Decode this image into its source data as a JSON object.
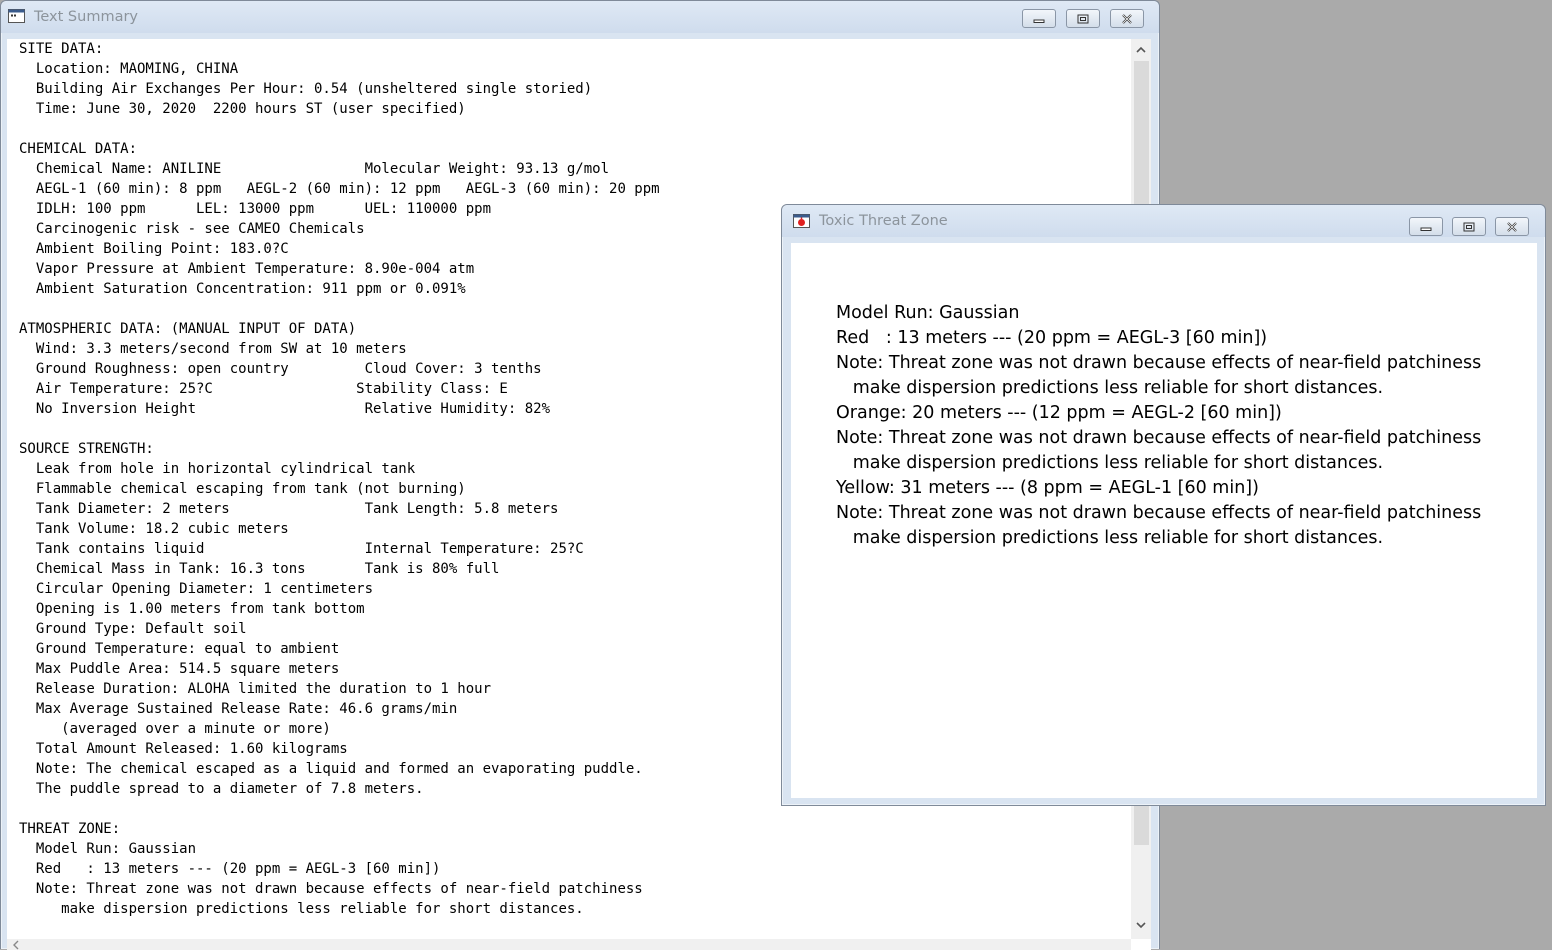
{
  "summary_window": {
    "title": "Text Summary",
    "lines": [
      "SITE DATA:",
      "  Location: MAOMING, CHINA",
      "  Building Air Exchanges Per Hour: 0.54 (unsheltered single storied)",
      "  Time: June 30, 2020  2200 hours ST (user specified)",
      "",
      "CHEMICAL DATA:",
      "  Chemical Name: ANILINE                 Molecular Weight: 93.13 g/mol",
      "  AEGL-1 (60 min): 8 ppm   AEGL-2 (60 min): 12 ppm   AEGL-3 (60 min): 20 ppm",
      "  IDLH: 100 ppm      LEL: 13000 ppm      UEL: 110000 ppm",
      "  Carcinogenic risk - see CAMEO Chemicals",
      "  Ambient Boiling Point: 183.0?C",
      "  Vapor Pressure at Ambient Temperature: 8.90e-004 atm",
      "  Ambient Saturation Concentration: 911 ppm or 0.091%",
      "",
      "ATMOSPHERIC DATA: (MANUAL INPUT OF DATA)",
      "  Wind: 3.3 meters/second from SW at 10 meters",
      "  Ground Roughness: open country         Cloud Cover: 3 tenths",
      "  Air Temperature: 25?C                 Stability Class: E",
      "  No Inversion Height                    Relative Humidity: 82%",
      "",
      "SOURCE STRENGTH:",
      "  Leak from hole in horizontal cylindrical tank",
      "  Flammable chemical escaping from tank (not burning)",
      "  Tank Diameter: 2 meters                Tank Length: 5.8 meters",
      "  Tank Volume: 18.2 cubic meters",
      "  Tank contains liquid                   Internal Temperature: 25?C",
      "  Chemical Mass in Tank: 16.3 tons       Tank is 80% full",
      "  Circular Opening Diameter: 1 centimeters",
      "  Opening is 1.00 meters from tank bottom",
      "  Ground Type: Default soil",
      "  Ground Temperature: equal to ambient",
      "  Max Puddle Area: 514.5 square meters",
      "  Release Duration: ALOHA limited the duration to 1 hour",
      "  Max Average Sustained Release Rate: 46.6 grams/min",
      "     (averaged over a minute or more)",
      "  Total Amount Released: 1.60 kilograms",
      "  Note: The chemical escaped as a liquid and formed an evaporating puddle.",
      "  The puddle spread to a diameter of 7.8 meters.",
      "",
      "THREAT ZONE:",
      "  Model Run: Gaussian",
      "  Red   : 13 meters --- (20 ppm = AEGL-3 [60 min])",
      "  Note: Threat zone was not drawn because effects of near-field patchiness",
      "     make dispersion predictions less reliable for short distances."
    ]
  },
  "toxic_window": {
    "title": "Toxic Threat Zone",
    "lines": [
      "Model Run: Gaussian",
      "Red   : 13 meters --- (20 ppm = AEGL-3 [60 min])",
      "Note: Threat zone was not drawn because effects of near-field patchiness",
      "   make dispersion predictions less reliable for short distances.",
      "Orange: 20 meters --- (12 ppm = AEGL-2 [60 min])",
      "Note: Threat zone was not drawn because effects of near-field patchiness",
      "   make dispersion predictions less reliable for short distances.",
      "Yellow: 31 meters --- (8 ppm = AEGL-1 [60 min])",
      "Note: Threat zone was not drawn because effects of near-field patchiness",
      "   make dispersion predictions less reliable for short distances."
    ]
  },
  "icons": {
    "summary_app": "document-window-icon",
    "toxic_app": "threat-zone-icon",
    "minimize": "minimize-icon",
    "maximize": "maximize-icon",
    "close": "close-icon",
    "scroll_up": "chevron-up-icon",
    "scroll_down": "chevron-down-icon",
    "scroll_left": "chevron-left-icon"
  },
  "colors": {
    "desktop": "#aaaaaa",
    "window_frame": "#d9e4f1",
    "title_text": "#8c949c",
    "client_bg": "#ffffff"
  }
}
